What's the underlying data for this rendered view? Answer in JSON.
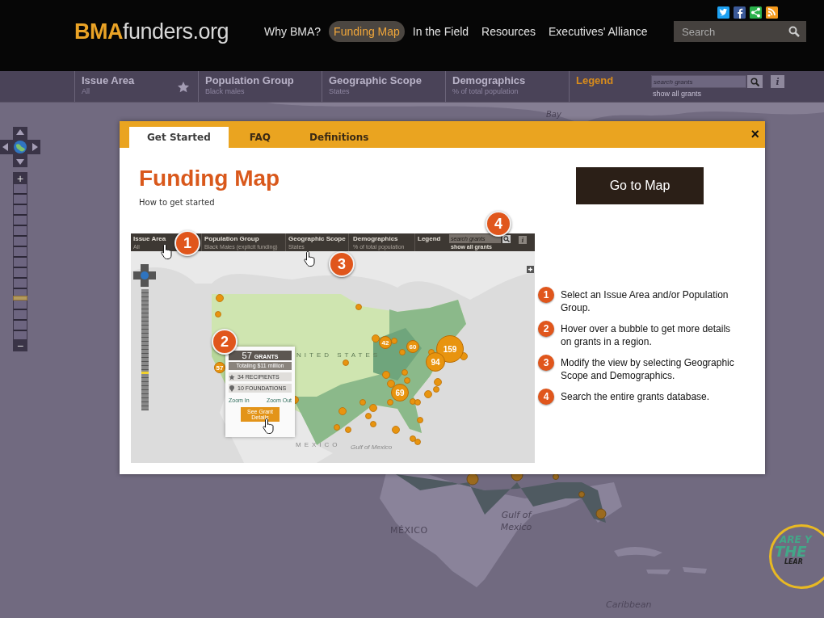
{
  "header": {
    "logo": "**BMA**funders.org",
    "nav": [
      {
        "label": "Why BMA?",
        "selected": false
      },
      {
        "label": "Funding Map",
        "selected": true
      },
      {
        "label": "In the Field",
        "selected": false
      },
      {
        "label": "Resources",
        "selected": false
      },
      {
        "label": "Executives' Alliance",
        "selected": false
      }
    ],
    "search": {
      "placeholder": "Search"
    }
  },
  "filter_bar": {
    "filters": [
      {
        "title": "Issue Area",
        "value": "All"
      },
      {
        "title": "Population Group",
        "value": "Black males"
      },
      {
        "title": "Geographic Scope",
        "value": "States"
      },
      {
        "title": "Demographics",
        "value": "% of total population"
      }
    ],
    "legend": "Legend",
    "search": {
      "placeholder": "search grants"
    },
    "show_all": "show all grants",
    "info": "i"
  },
  "map": {
    "labels": [
      "Bay",
      "MÉXICO",
      "Gulf of Mexico",
      "Caribbean"
    ],
    "zoom": {
      "level": 0.25,
      "zoom_in": "+",
      "zoom_out": "−"
    },
    "badge": [
      "ARE Y",
      "THE",
      "LEAR"
    ]
  },
  "modal": {
    "tabs": [
      {
        "label": "Get Started",
        "selected": true
      },
      {
        "label": "FAQ",
        "selected": false
      },
      {
        "label": "Definitions",
        "selected": false
      }
    ],
    "close": "×",
    "title": "Funding Map",
    "subtitle": "How to get started",
    "button": "Go to Map",
    "preview": {
      "filters": [
        {
          "title": "Issue Area",
          "value": "All"
        },
        {
          "title": "Population Group",
          "value": "Black Males (explicit funding)"
        },
        {
          "title": "Geographic Scope",
          "value": "States"
        },
        {
          "title": "Demographics",
          "value": "% of total population"
        }
      ],
      "legend": "Legend",
      "search": {
        "placeholder": "search grants"
      },
      "show_all": "show all grants",
      "info": "i",
      "callouts": [
        "1",
        "2",
        "3",
        "4"
      ],
      "bubbles": [
        "42",
        "60",
        "159",
        "94",
        "69",
        "57"
      ],
      "popup": {
        "count": "57",
        "unit": "GRANTS",
        "total": "Totaling $11 million",
        "recipients": "34 RECIPIENTS",
        "foundations": "10 FOUNDATIONS",
        "zoom_in": "Zoom In",
        "zoom_out": "Zoom Out",
        "button": "See Grant Details"
      },
      "labels": [
        "NITED STATES",
        "Gulf of Mexico",
        "MEXICO"
      ],
      "zoom": {
        "level": 0.3
      }
    },
    "steps": [
      {
        "number": "1",
        "text": "Select an Issue Area and/or Population Group."
      },
      {
        "number": "2",
        "text": "Hover over a bubble to get more details on grants in a region."
      },
      {
        "number": "3",
        "text": "Modify the view by selecting Geographic Scope and Demographics."
      },
      {
        "number": "4",
        "text": "Search the entire grants database."
      }
    ]
  }
}
